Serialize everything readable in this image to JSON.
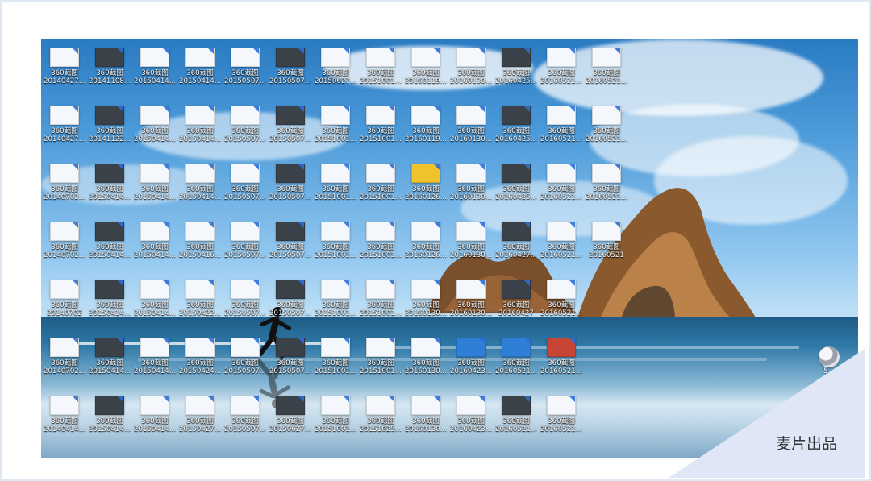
{
  "watermark": "麦片出品",
  "system_icon_label": "5...",
  "icon_label_top": "360截图",
  "icons": [
    {
      "row": 0,
      "col": 0,
      "date": "20140427..."
    },
    {
      "row": 0,
      "col": 1,
      "date": "20141108..."
    },
    {
      "row": 0,
      "col": 2,
      "date": "20150414..."
    },
    {
      "row": 0,
      "col": 3,
      "date": "20150414..."
    },
    {
      "row": 0,
      "col": 4,
      "date": "20150507..."
    },
    {
      "row": 0,
      "col": 5,
      "date": "20150507..."
    },
    {
      "row": 0,
      "col": 6,
      "date": "20150627..."
    },
    {
      "row": 0,
      "col": 7,
      "date": "20151001..."
    },
    {
      "row": 0,
      "col": 8,
      "date": "20160119..."
    },
    {
      "row": 0,
      "col": 9,
      "date": "20160130..."
    },
    {
      "row": 0,
      "col": 10,
      "date": "20160425..."
    },
    {
      "row": 0,
      "col": 11,
      "date": "20160521..."
    },
    {
      "row": 0,
      "col": 12,
      "date": "20160521..."
    },
    {
      "row": 1,
      "col": 0,
      "date": "20140427..."
    },
    {
      "row": 1,
      "col": 1,
      "date": "20141122..."
    },
    {
      "row": 1,
      "col": 2,
      "date": "20150414..."
    },
    {
      "row": 1,
      "col": 3,
      "date": "20150414..."
    },
    {
      "row": 1,
      "col": 4,
      "date": "20150507..."
    },
    {
      "row": 1,
      "col": 5,
      "date": "20150507..."
    },
    {
      "row": 1,
      "col": 6,
      "date": "20151001..."
    },
    {
      "row": 1,
      "col": 7,
      "date": "20151001..."
    },
    {
      "row": 1,
      "col": 8,
      "date": "20160119..."
    },
    {
      "row": 1,
      "col": 9,
      "date": "20160130..."
    },
    {
      "row": 1,
      "col": 10,
      "date": "20160425..."
    },
    {
      "row": 1,
      "col": 11,
      "date": "20160521..."
    },
    {
      "row": 1,
      "col": 12,
      "date": "20160521..."
    },
    {
      "row": 2,
      "col": 0,
      "date": "20140702..."
    },
    {
      "row": 2,
      "col": 1,
      "date": "20150414..."
    },
    {
      "row": 2,
      "col": 2,
      "date": "20150414..."
    },
    {
      "row": 2,
      "col": 3,
      "date": "20150414..."
    },
    {
      "row": 2,
      "col": 4,
      "date": "20150507..."
    },
    {
      "row": 2,
      "col": 5,
      "date": "20150507..."
    },
    {
      "row": 2,
      "col": 6,
      "date": "20151001..."
    },
    {
      "row": 2,
      "col": 7,
      "date": "20151001..."
    },
    {
      "row": 2,
      "col": 8,
      "date": "20160126..."
    },
    {
      "row": 2,
      "col": 9,
      "date": "20160130..."
    },
    {
      "row": 2,
      "col": 10,
      "date": "20160425..."
    },
    {
      "row": 2,
      "col": 11,
      "date": "20160521..."
    },
    {
      "row": 2,
      "col": 12,
      "date": "20160521..."
    },
    {
      "row": 3,
      "col": 0,
      "date": "20140702..."
    },
    {
      "row": 3,
      "col": 1,
      "date": "20150414..."
    },
    {
      "row": 3,
      "col": 2,
      "date": "20150414..."
    },
    {
      "row": 3,
      "col": 3,
      "date": "20150416..."
    },
    {
      "row": 3,
      "col": 4,
      "date": "20150507..."
    },
    {
      "row": 3,
      "col": 5,
      "date": "20150507..."
    },
    {
      "row": 3,
      "col": 6,
      "date": "20151001..."
    },
    {
      "row": 3,
      "col": 7,
      "date": "20151001..."
    },
    {
      "row": 3,
      "col": 8,
      "date": "20160126..."
    },
    {
      "row": 3,
      "col": 9,
      "date": "20160130..."
    },
    {
      "row": 3,
      "col": 10,
      "date": "20160427..."
    },
    {
      "row": 3,
      "col": 11,
      "date": "20160521..."
    },
    {
      "row": 3,
      "col": 12,
      "date": "20160521"
    },
    {
      "row": 4,
      "col": 0,
      "date": "20140702"
    },
    {
      "row": 4,
      "col": 1,
      "date": "20150414..."
    },
    {
      "row": 4,
      "col": 2,
      "date": "20150414..."
    },
    {
      "row": 4,
      "col": 3,
      "date": "20150422..."
    },
    {
      "row": 4,
      "col": 4,
      "date": "20150507..."
    },
    {
      "row": 4,
      "col": 5,
      "date": "20150507..."
    },
    {
      "row": 4,
      "col": 6,
      "date": "20151001..."
    },
    {
      "row": 4,
      "col": 7,
      "date": "20151001..."
    },
    {
      "row": 4,
      "col": 8,
      "date": "20160130..."
    },
    {
      "row": 4,
      "col": 9,
      "date": "20160130..."
    },
    {
      "row": 4,
      "col": 10,
      "date": "20160427"
    },
    {
      "row": 4,
      "col": 11,
      "date": "20160521..."
    },
    {
      "row": 5,
      "col": 0,
      "date": "20140702..."
    },
    {
      "row": 5,
      "col": 1,
      "date": "20150414..."
    },
    {
      "row": 5,
      "col": 2,
      "date": "20150414..."
    },
    {
      "row": 5,
      "col": 3,
      "date": "20150424..."
    },
    {
      "row": 5,
      "col": 4,
      "date": "20150507..."
    },
    {
      "row": 5,
      "col": 5,
      "date": "20150507..."
    },
    {
      "row": 5,
      "col": 6,
      "date": "20151001..."
    },
    {
      "row": 5,
      "col": 7,
      "date": "20151001..."
    },
    {
      "row": 5,
      "col": 8,
      "date": "20160130..."
    },
    {
      "row": 5,
      "col": 9,
      "date": "20160423..."
    },
    {
      "row": 5,
      "col": 10,
      "date": "20160521..."
    },
    {
      "row": 5,
      "col": 11,
      "date": "20160521..."
    },
    {
      "row": 6,
      "col": 0,
      "date": "20140414..."
    },
    {
      "row": 6,
      "col": 1,
      "date": "20150414..."
    },
    {
      "row": 6,
      "col": 2,
      "date": "20150414..."
    },
    {
      "row": 6,
      "col": 3,
      "date": "20150427..."
    },
    {
      "row": 6,
      "col": 4,
      "date": "20150507..."
    },
    {
      "row": 6,
      "col": 5,
      "date": "20150627..."
    },
    {
      "row": 6,
      "col": 6,
      "date": "20151001..."
    },
    {
      "row": 6,
      "col": 7,
      "date": "20151025..."
    },
    {
      "row": 6,
      "col": 8,
      "date": "20160130..."
    },
    {
      "row": 6,
      "col": 9,
      "date": "20160423..."
    },
    {
      "row": 6,
      "col": 10,
      "date": "20160521..."
    },
    {
      "row": 6,
      "col": 11,
      "date": "20160521..."
    }
  ]
}
